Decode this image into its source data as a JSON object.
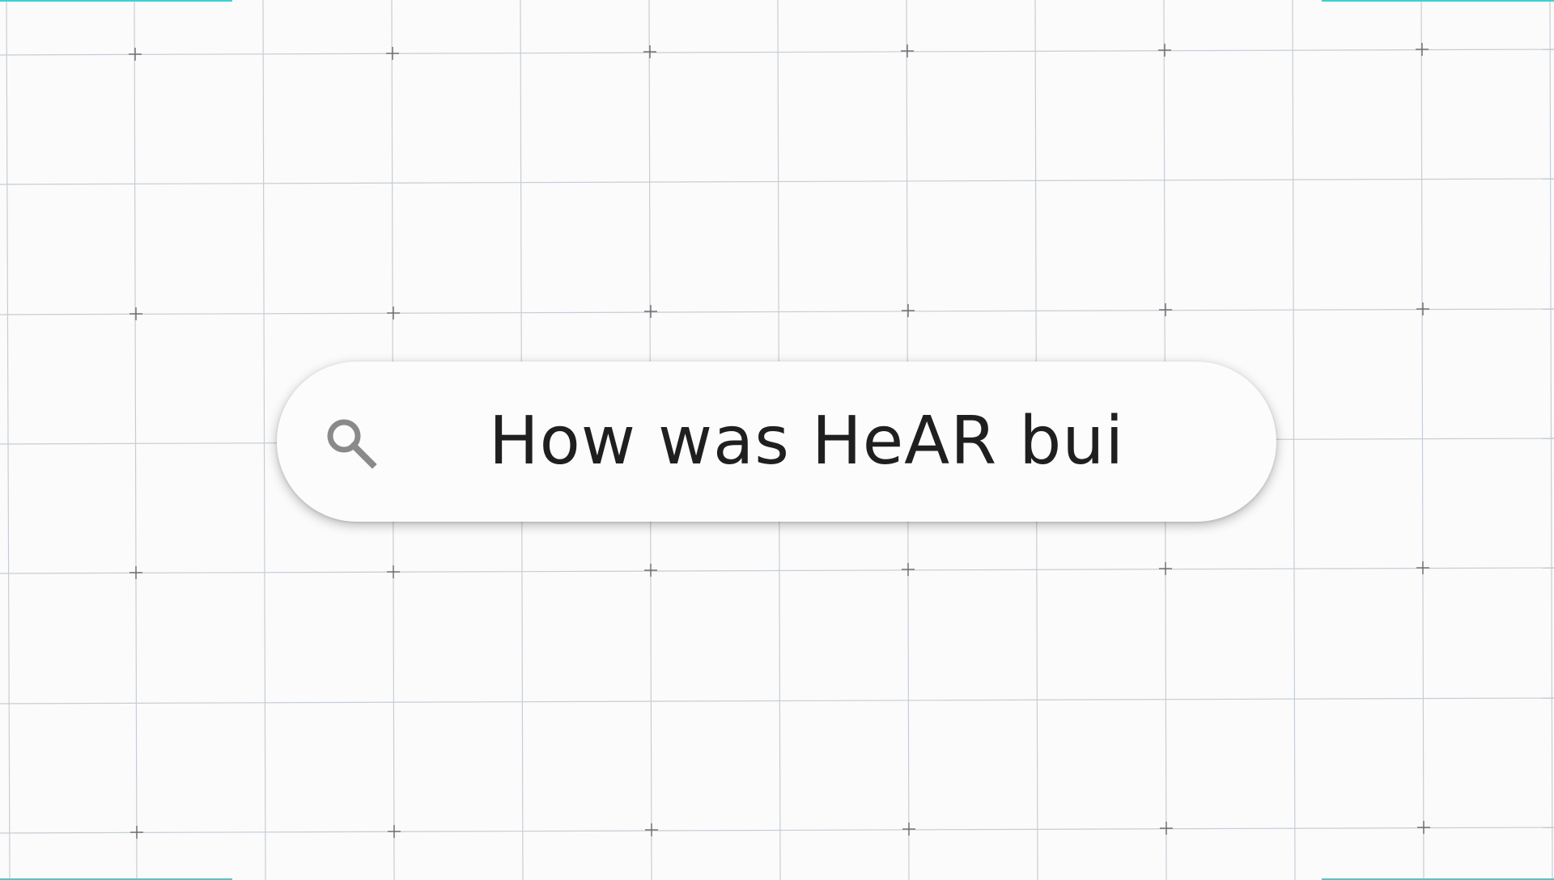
{
  "search": {
    "query_text": "How was HeAR bui"
  },
  "icons": {
    "search": "search-icon"
  },
  "colors": {
    "background": "#fbfbfb",
    "grid_line": "#c7cdd4",
    "grid_cross": "#6b6b6b",
    "search_bar": "#fcfcfc",
    "text": "#1f1f1f",
    "icon": "#8a8a8a",
    "accent": "#4fc9c9"
  }
}
